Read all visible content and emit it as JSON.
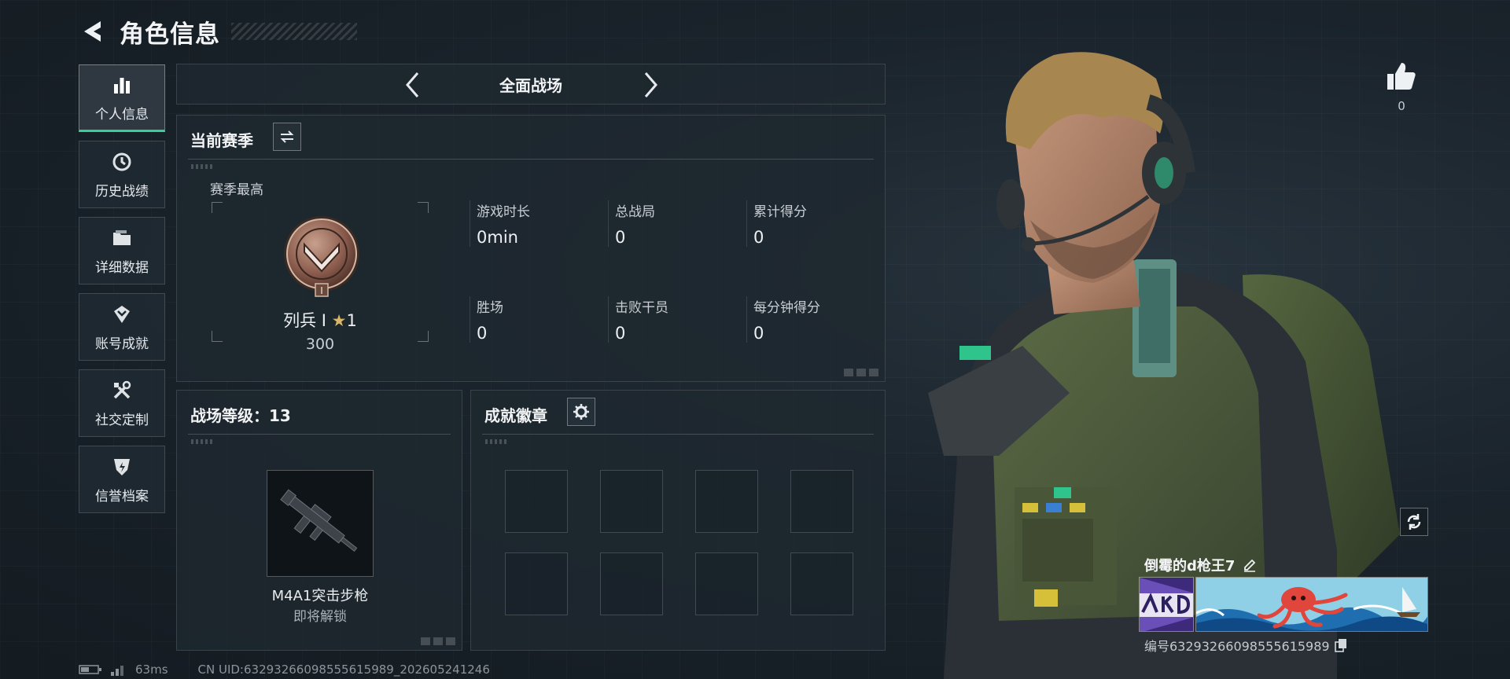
{
  "header": {
    "title": "角色信息"
  },
  "sidebar": {
    "items": [
      {
        "label": "个人信息",
        "icon": "bar-chart-icon",
        "active": true
      },
      {
        "label": "历史战绩",
        "icon": "history-icon",
        "active": false
      },
      {
        "label": "详细数据",
        "icon": "folder-icon",
        "active": false
      },
      {
        "label": "账号成就",
        "icon": "achievement-icon",
        "active": false
      },
      {
        "label": "社交定制",
        "icon": "tools-icon",
        "active": false
      },
      {
        "label": "信誉档案",
        "icon": "shield-icon",
        "active": false
      }
    ]
  },
  "mode": {
    "name": "全面战场"
  },
  "season": {
    "title": "当前赛季",
    "best_label": "赛季最高",
    "rank": {
      "name": "列兵 Ⅰ",
      "stars": "1",
      "points": "300",
      "emblem_tier": "I"
    },
    "stats": [
      {
        "label": "游戏时长",
        "value": "0min"
      },
      {
        "label": "总战局",
        "value": "0"
      },
      {
        "label": "累计得分",
        "value": "0"
      },
      {
        "label": "胜场",
        "value": "0"
      },
      {
        "label": "击败干员",
        "value": "0"
      },
      {
        "label": "每分钟得分",
        "value": "0"
      }
    ]
  },
  "level": {
    "title": "战场等级：13",
    "weapon_name": "M4A1突击步枪",
    "weapon_status": "即将解锁"
  },
  "badges": {
    "title": "成就徽章",
    "slot_count": 8
  },
  "profile": {
    "likes": "0",
    "player_name": "倒霉的d枪王7",
    "player_id": "编号6329326609855561​5989"
  },
  "status": {
    "ping": "63ms",
    "uid": "CN UID:6329326609855561​5989_202605241246"
  },
  "colors": {
    "accent": "#2fd39a",
    "panel": "#1e2830",
    "background": "#1a232b"
  }
}
